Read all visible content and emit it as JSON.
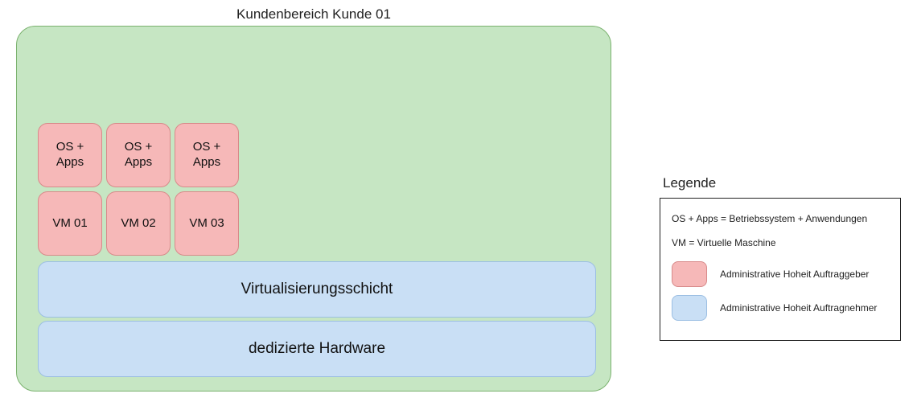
{
  "title": "Kundenbereich Kunde 01",
  "colors": {
    "customerArea": "#c6e6c3",
    "customerAreaBorder": "#7bb26f",
    "clientBox": "#f6b8b8",
    "clientBoxBorder": "#d88a8a",
    "providerBox": "#c9dff5",
    "providerBoxBorder": "#9cbfe3"
  },
  "osApps": [
    "OS + Apps",
    "OS + Apps",
    "OS + Apps"
  ],
  "vms": [
    "VM 01",
    "VM 02",
    "VM 03"
  ],
  "layers": {
    "virtualization": "Virtualisierungsschicht",
    "hardware": "dedizierte Hardware"
  },
  "legend": {
    "title": "Legende",
    "osAppsDef": "OS + Apps = Betriebssystem + Anwendungen",
    "vmDef": "VM = Virtuelle Maschine",
    "clientAuthority": "Administrative Hoheit Auftraggeber",
    "providerAuthority": "Administrative Hoheit Auftragnehmer"
  }
}
